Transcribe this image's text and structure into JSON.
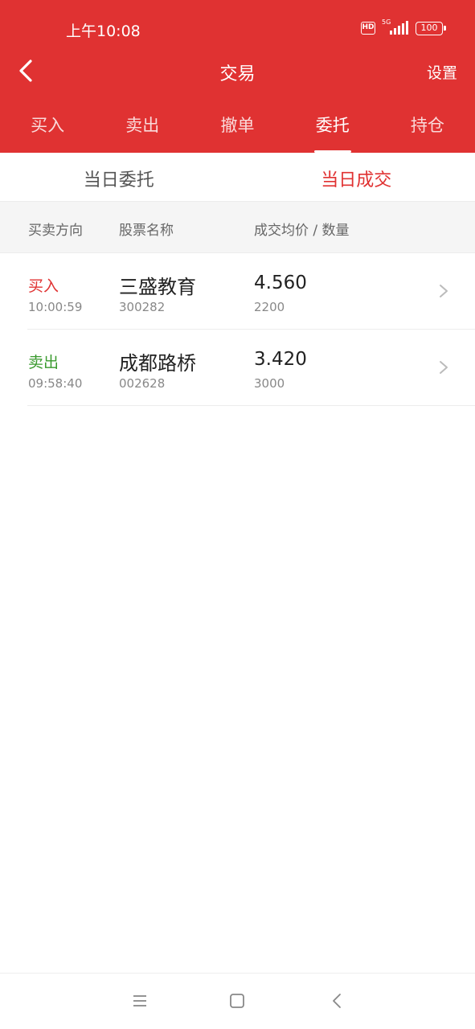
{
  "status_bar": {
    "time": "上午10:08",
    "hd_label": "HD",
    "network_label": "5G",
    "battery_level": "100"
  },
  "nav": {
    "title": "交易",
    "settings_label": "设置",
    "back_icon": "chevron-left-icon"
  },
  "main_tabs": [
    {
      "label": "买入",
      "active": false
    },
    {
      "label": "卖出",
      "active": false
    },
    {
      "label": "撤单",
      "active": false
    },
    {
      "label": "委托",
      "active": true
    },
    {
      "label": "持仓",
      "active": false
    }
  ],
  "sub_tabs": [
    {
      "label": "当日委托",
      "active": false
    },
    {
      "label": "当日成交",
      "active": true
    }
  ],
  "columns": {
    "direction": "买卖方向",
    "stock_name": "股票名称",
    "price_qty": "成交均价 / 数量"
  },
  "trades": [
    {
      "direction": "买入",
      "type": "buy",
      "time": "10:00:59",
      "name": "三盛教育",
      "code": "300282",
      "price": "4.560",
      "quantity": "2200"
    },
    {
      "direction": "卖出",
      "type": "sell",
      "time": "09:58:40",
      "name": "成都路桥",
      "code": "002628",
      "price": "3.420",
      "quantity": "3000"
    }
  ],
  "colors": {
    "brand_red": "#e03232",
    "sell_green": "#3a9a2e"
  },
  "system_nav": [
    "menu-icon",
    "home-icon",
    "back-icon"
  ]
}
